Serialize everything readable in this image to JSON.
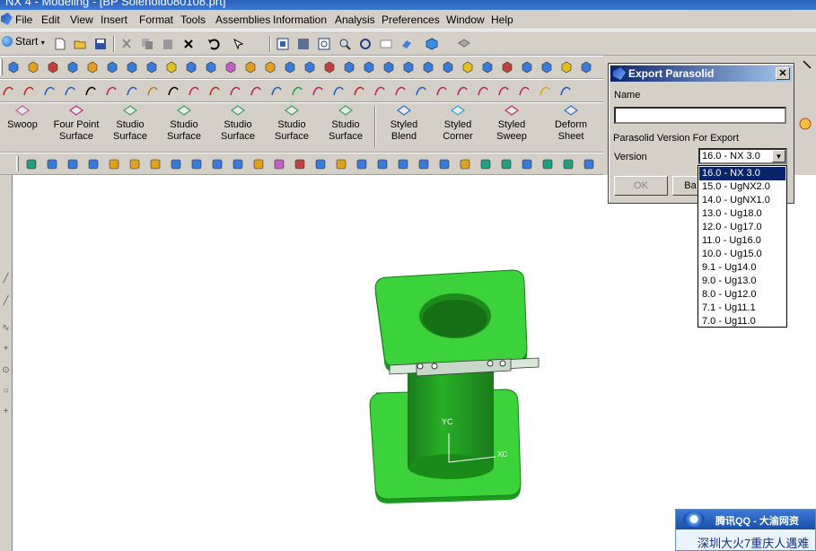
{
  "window": {
    "title": "NX 4 - Modeling - [BP Solenoid080108.prt]"
  },
  "menu": {
    "items": [
      {
        "label": "File"
      },
      {
        "label": "Edit"
      },
      {
        "label": "View"
      },
      {
        "label": "Insert"
      },
      {
        "label": "Format"
      },
      {
        "label": "Tools"
      },
      {
        "label": "Assemblies"
      },
      {
        "label": "Information"
      },
      {
        "label": "Analysis"
      },
      {
        "label": "Preferences"
      },
      {
        "label": "Window"
      },
      {
        "label": "Help"
      }
    ]
  },
  "standard_toolbar": {
    "start_label": "Start"
  },
  "surface_toolbar": {
    "buttons": [
      {
        "l1": "Swoop",
        "l2": "",
        "icon": "swoop-icon",
        "color": "#c060a0"
      },
      {
        "l1": "Four Point",
        "l2": "Surface",
        "icon": "four-point-surface-icon",
        "color": "#c03080"
      },
      {
        "l1": "Studio",
        "l2": "Surface",
        "icon": "studio-surface-icon",
        "color": "#40a060"
      },
      {
        "l1": "Studio",
        "l2": "Surface",
        "icon": "studio-surface-icon",
        "color": "#40a060"
      },
      {
        "l1": "Studio",
        "l2": "Surface",
        "icon": "studio-surface-icon",
        "color": "#40a060"
      },
      {
        "l1": "Studio",
        "l2": "Surface",
        "icon": "studio-surface-icon",
        "color": "#40a060"
      },
      {
        "l1": "Studio",
        "l2": "Surface",
        "icon": "studio-surface-icon",
        "color": "#40a060"
      },
      {
        "l1": "Styled",
        "l2": "Blend",
        "icon": "styled-blend-icon",
        "color": "#3070d0"
      },
      {
        "l1": "Styled",
        "l2": "Corner",
        "icon": "styled-corner-icon",
        "color": "#30a0d0"
      },
      {
        "l1": "Styled",
        "l2": "Sweep",
        "icon": "styled-sweep-icon",
        "color": "#c03060"
      },
      {
        "l1": "Deform",
        "l2": "Sheet",
        "icon": "deform-sheet-icon",
        "color": "#3070d0"
      }
    ]
  },
  "viewport": {
    "axis_label_y": "YC",
    "axis_label_x": "XC",
    "model_color": "#3cd23c"
  },
  "dialog": {
    "title": "Export Parasolid",
    "name_label": "Name",
    "name_value": "",
    "version_section_label": "Parasolid Version For Export",
    "version_label": "Version",
    "version_selected": "16.0 - NX 3.0",
    "ok_label": "OK",
    "back_label": "Ba",
    "versions": [
      "16.0 - NX 3.0",
      "15.0 - UgNX2.0",
      "14.0 - UgNX1.0",
      "13.0 - Ug18.0",
      "12.0 - Ug17.0",
      "11.0 - Ug16.0",
      "10.0 - Ug15.0",
      "9.1 - Ug14.0",
      "9.0 - Ug13.0",
      "8.0 - Ug12.0",
      "7.1 - Ug11.1",
      "7.0 - Ug11.0"
    ]
  },
  "qq_popup": {
    "title": "腾讯QQ - 大渝网资",
    "text": "深圳大火7重庆人遇难"
  }
}
